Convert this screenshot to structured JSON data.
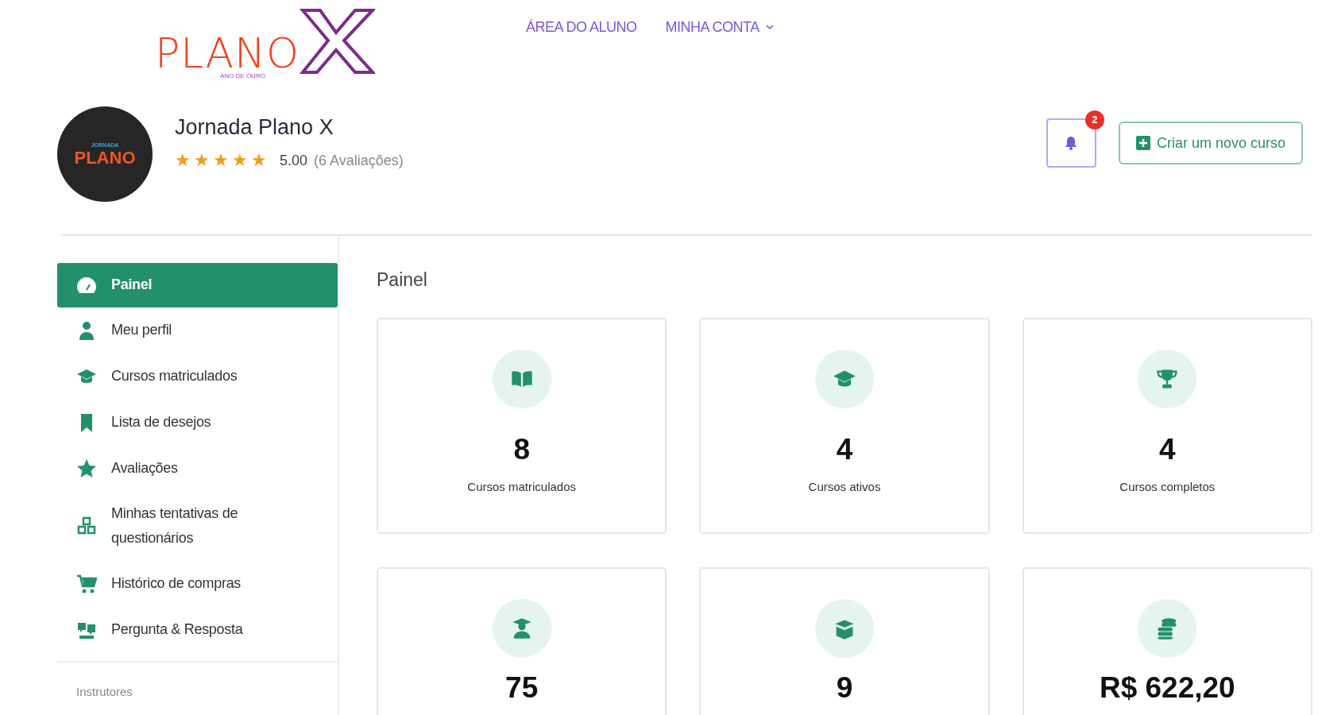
{
  "header": {
    "logo": {
      "word": "PLANO",
      "tagline": "ANO DE OURO"
    },
    "nav": [
      {
        "label": "ÁREA DO ALUNO",
        "dropdown": false
      },
      {
        "label": "MINHA CONTA",
        "dropdown": true
      }
    ]
  },
  "profile": {
    "avatar": {
      "top": "JORNADA",
      "main": "PLANO"
    },
    "name": "Jornada Plano X",
    "stars": 5,
    "rating": "5.00",
    "reviews": "(6 Avaliações)",
    "notifications": "2",
    "create_button": "Criar um novo curso"
  },
  "sidebar": {
    "items": [
      {
        "kind": "gauge",
        "label": "Painel",
        "selected": true
      },
      {
        "kind": "user",
        "label": "Meu perfil",
        "selected": false
      },
      {
        "kind": "cap",
        "label": "Cursos matriculados",
        "selected": false
      },
      {
        "kind": "bookmark",
        "label": "Lista de desejos",
        "selected": false
      },
      {
        "kind": "star",
        "label": "Avaliações",
        "selected": false
      },
      {
        "kind": "shapes",
        "label": "Minhas tentativas de questionários",
        "selected": false
      },
      {
        "kind": "cart",
        "label": "Histórico de compras",
        "selected": false
      },
      {
        "kind": "qa",
        "label": "Pergunta & Resposta",
        "selected": false
      }
    ],
    "section": "Instrutores"
  },
  "main": {
    "title": "Painel",
    "stats": [
      {
        "kind": "book",
        "value": "8",
        "label": "Cursos matriculados"
      },
      {
        "kind": "cap",
        "value": "4",
        "label": "Cursos ativos"
      },
      {
        "kind": "trophy",
        "value": "4",
        "label": "Cursos completos"
      },
      {
        "kind": "student",
        "value": "75"
      },
      {
        "kind": "box",
        "value": "9"
      },
      {
        "kind": "coins",
        "value": "R$ 622,20"
      }
    ]
  }
}
